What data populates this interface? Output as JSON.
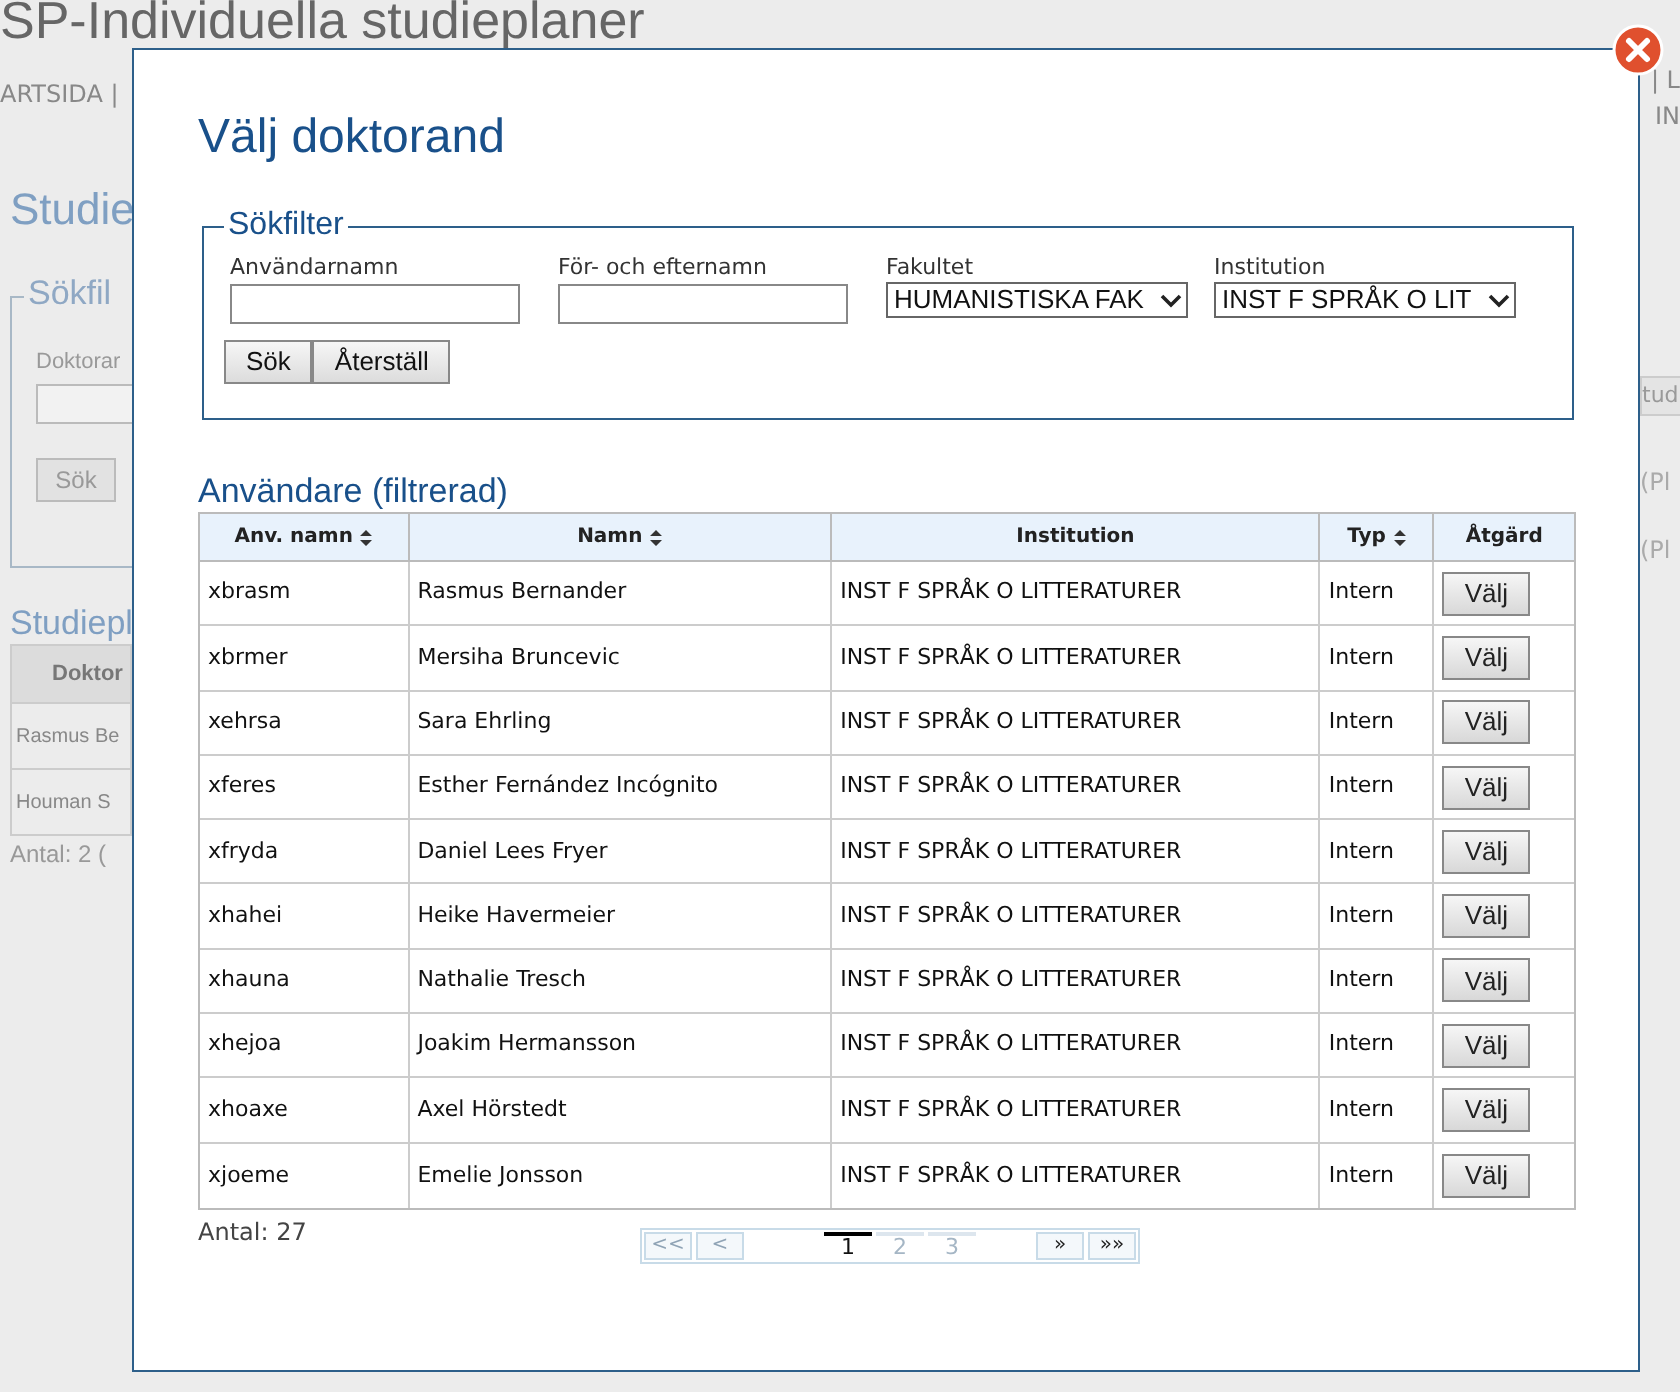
{
  "background": {
    "title": "SP-Individuella studieplaner",
    "nav_left": "ARTSIDA |",
    "nav_right_top": "| L",
    "nav_right": "IN",
    "heading": "Studie",
    "filter_legend": "Sökfil",
    "filter_label": "Doktorar",
    "search_button": "Sök",
    "plans_heading": "Studiepl",
    "table_header": "Doktor",
    "rows": [
      "Rasmus Be",
      "Houman S"
    ],
    "count": "Antal: 2 (",
    "right_button": "tud",
    "right_cells": [
      "(Pl",
      "(Pl"
    ]
  },
  "dialog": {
    "title": "Välj doktorand",
    "filter": {
      "legend": "Sökfilter",
      "fields": [
        {
          "label": "Användarnamn",
          "kind": "text"
        },
        {
          "label": "För- och efternamn",
          "kind": "text"
        },
        {
          "label": "Fakultet",
          "kind": "select",
          "value": "HUMANISTISKA FAK"
        },
        {
          "label": "Institution",
          "kind": "select",
          "value": "INST F SPRÅK O LIT"
        }
      ],
      "buttons": [
        "Sök",
        "Återställ"
      ]
    },
    "table": {
      "title": "Användare (filtrerad)",
      "columns": [
        {
          "label": "Anv. namn",
          "sortable": true
        },
        {
          "label": "Namn",
          "sortable": true
        },
        {
          "label": "Institution",
          "sortable": false
        },
        {
          "label": "Typ",
          "sortable": true
        },
        {
          "label": "Åtgärd",
          "sortable": false
        }
      ],
      "rows": [
        [
          "xbrasm",
          "Rasmus Bernander",
          "INST F SPRÅK O LITTERATURER",
          "Intern",
          "Välj"
        ],
        [
          "xbrmer",
          "Mersiha Bruncevic",
          "INST F SPRÅK O LITTERATURER",
          "Intern",
          "Välj"
        ],
        [
          "xehrsa",
          "Sara Ehrling",
          "INST F SPRÅK O LITTERATURER",
          "Intern",
          "Välj"
        ],
        [
          "xferes",
          "Esther Fernández Incógnito",
          "INST F SPRÅK O LITTERATURER",
          "Intern",
          "Välj"
        ],
        [
          "xfryda",
          "Daniel Lees Fryer",
          "INST F SPRÅK O LITTERATURER",
          "Intern",
          "Välj"
        ],
        [
          "xhahei",
          "Heike Havermeier",
          "INST F SPRÅK O LITTERATURER",
          "Intern",
          "Välj"
        ],
        [
          "xhauna",
          "Nathalie Tresch",
          "INST F SPRÅK O LITTERATURER",
          "Intern",
          "Välj"
        ],
        [
          "xhejoa",
          "Joakim Hermansson",
          "INST F SPRÅK O LITTERATURER",
          "Intern",
          "Välj"
        ],
        [
          "xhoaxe",
          "Axel Hörstedt",
          "INST F SPRÅK O LITTERATURER",
          "Intern",
          "Välj"
        ],
        [
          "xjoeme",
          "Emelie Jonsson",
          "INST F SPRÅK O LITTERATURER",
          "Intern",
          "Välj"
        ]
      ]
    },
    "count": "Antal: 27",
    "pagination": {
      "first": {
        "label": "<<",
        "disabled": true
      },
      "prev": {
        "label": "<",
        "disabled": true
      },
      "pages": [
        {
          "label": "1",
          "selected": true
        },
        {
          "label": "2",
          "selected": false
        },
        {
          "label": "3",
          "selected": false
        }
      ],
      "next": {
        "label": "»",
        "disabled": false
      },
      "last": {
        "label": "»»",
        "disabled": false
      }
    }
  }
}
